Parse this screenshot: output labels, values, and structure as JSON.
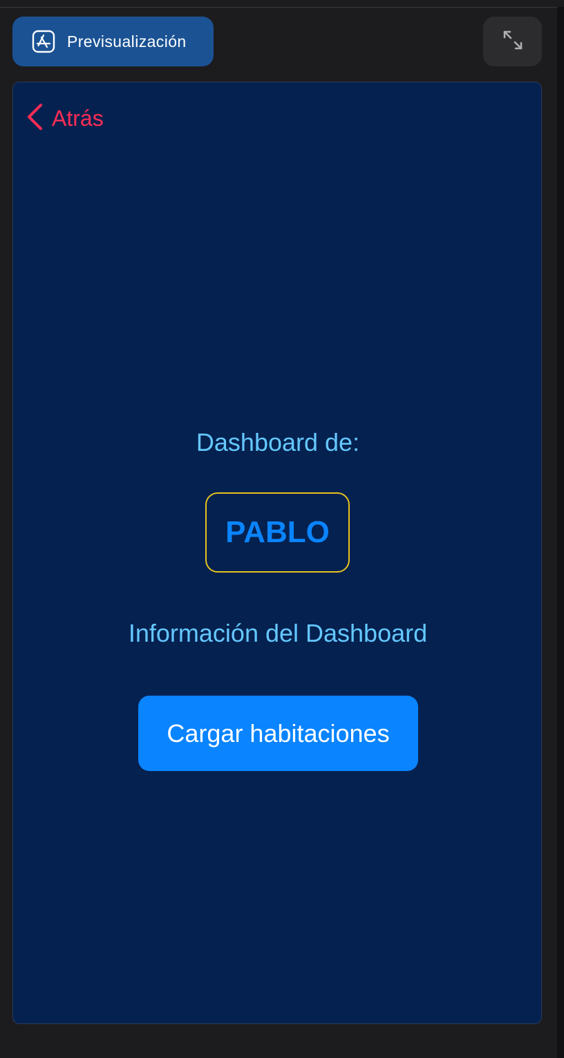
{
  "toolbar": {
    "preview_label": "Previsualización",
    "preview_icon": "app-store-icon",
    "expand_icon": "expand-arrows-icon"
  },
  "screen": {
    "back_label": "Atrás",
    "back_icon": "chevron-left-icon",
    "dashboard_title": "Dashboard de:",
    "user_name": "PABLO",
    "info_text": "Información del Dashboard",
    "load_button_label": "Cargar habitaciones"
  },
  "colors": {
    "background": "#1c1c1e",
    "preview_button": "#1b5294",
    "screen_background": "#05214f",
    "back_accent": "#ff2d55",
    "text_light_blue": "#64c8ff",
    "name_border": "#e8c41e",
    "primary_blue": "#0a84ff"
  }
}
